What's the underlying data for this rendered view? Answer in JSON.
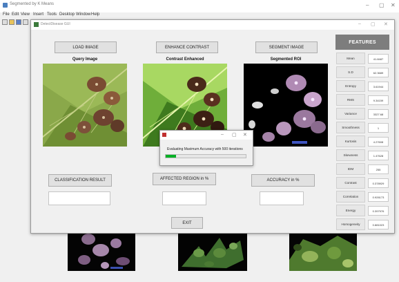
{
  "background_window": {
    "title": "Segmented by K Means",
    "menu": [
      "File",
      "Edit",
      "View",
      "Insert",
      "Tools",
      "Desktop",
      "Window",
      "Help"
    ],
    "controls": {
      "minimize": "–",
      "maximize": "▢",
      "close": "✕"
    }
  },
  "dialog": {
    "title": "DetectDisease GUI",
    "controls": {
      "minimize": "–",
      "maximize": "▢",
      "close": "✕"
    },
    "buttons": {
      "load_image": "LOAD IMAGE",
      "enhance_contrast": "ENHANCE CONTRAST",
      "segment_image": "SEGMENT IMAGE",
      "exit": "EXIT"
    },
    "image_labels": {
      "query": "Query Image",
      "enhanced": "Contrast Enhanced",
      "segmented": "Segmented ROI"
    },
    "result_labels": {
      "classification": "CLASSIFICATION RESULT",
      "affected_region": "AFFECTED REGION in %",
      "accuracy": "ACCURACY in %"
    },
    "result_values": {
      "classification": "",
      "affected_region": "",
      "accuracy": ""
    }
  },
  "features": {
    "header": "FEATURES",
    "items": [
      {
        "label": "Mean",
        "value": "41.8487"
      },
      {
        "label": "S.D",
        "value": "62.3689"
      },
      {
        "label": "Entropy",
        "value": "3.61944"
      },
      {
        "label": "RMS",
        "value": "9.34159"
      },
      {
        "label": "Variance",
        "value": "3327.68"
      },
      {
        "label": "Smoothness",
        "value": "1"
      },
      {
        "label": "Kurtosis",
        "value": "4.27608"
      },
      {
        "label": "Skewness",
        "value": "1.47628"
      },
      {
        "label": "IDM",
        "value": "255"
      },
      {
        "label": "Contrast",
        "value": "0.378929"
      },
      {
        "label": "Correlation",
        "value": "0.926173"
      },
      {
        "label": "Energy",
        "value": "0.397976"
      },
      {
        "label": "Homogeneity",
        "value": "0.881023"
      }
    ]
  },
  "progress": {
    "controls": {
      "minimize": "–",
      "maximize": "▢",
      "close": "✕"
    },
    "message": "Evaluating Maximum Accuracy with 500 iterations",
    "fraction": 0.13
  },
  "colors": {
    "features_header": "#7d7d7d",
    "progress_fill": "#06b025",
    "leaf_green": "#7a9a3a",
    "lesion_brown": "#7a4b33",
    "lesion_purple": "#b48ab8"
  }
}
